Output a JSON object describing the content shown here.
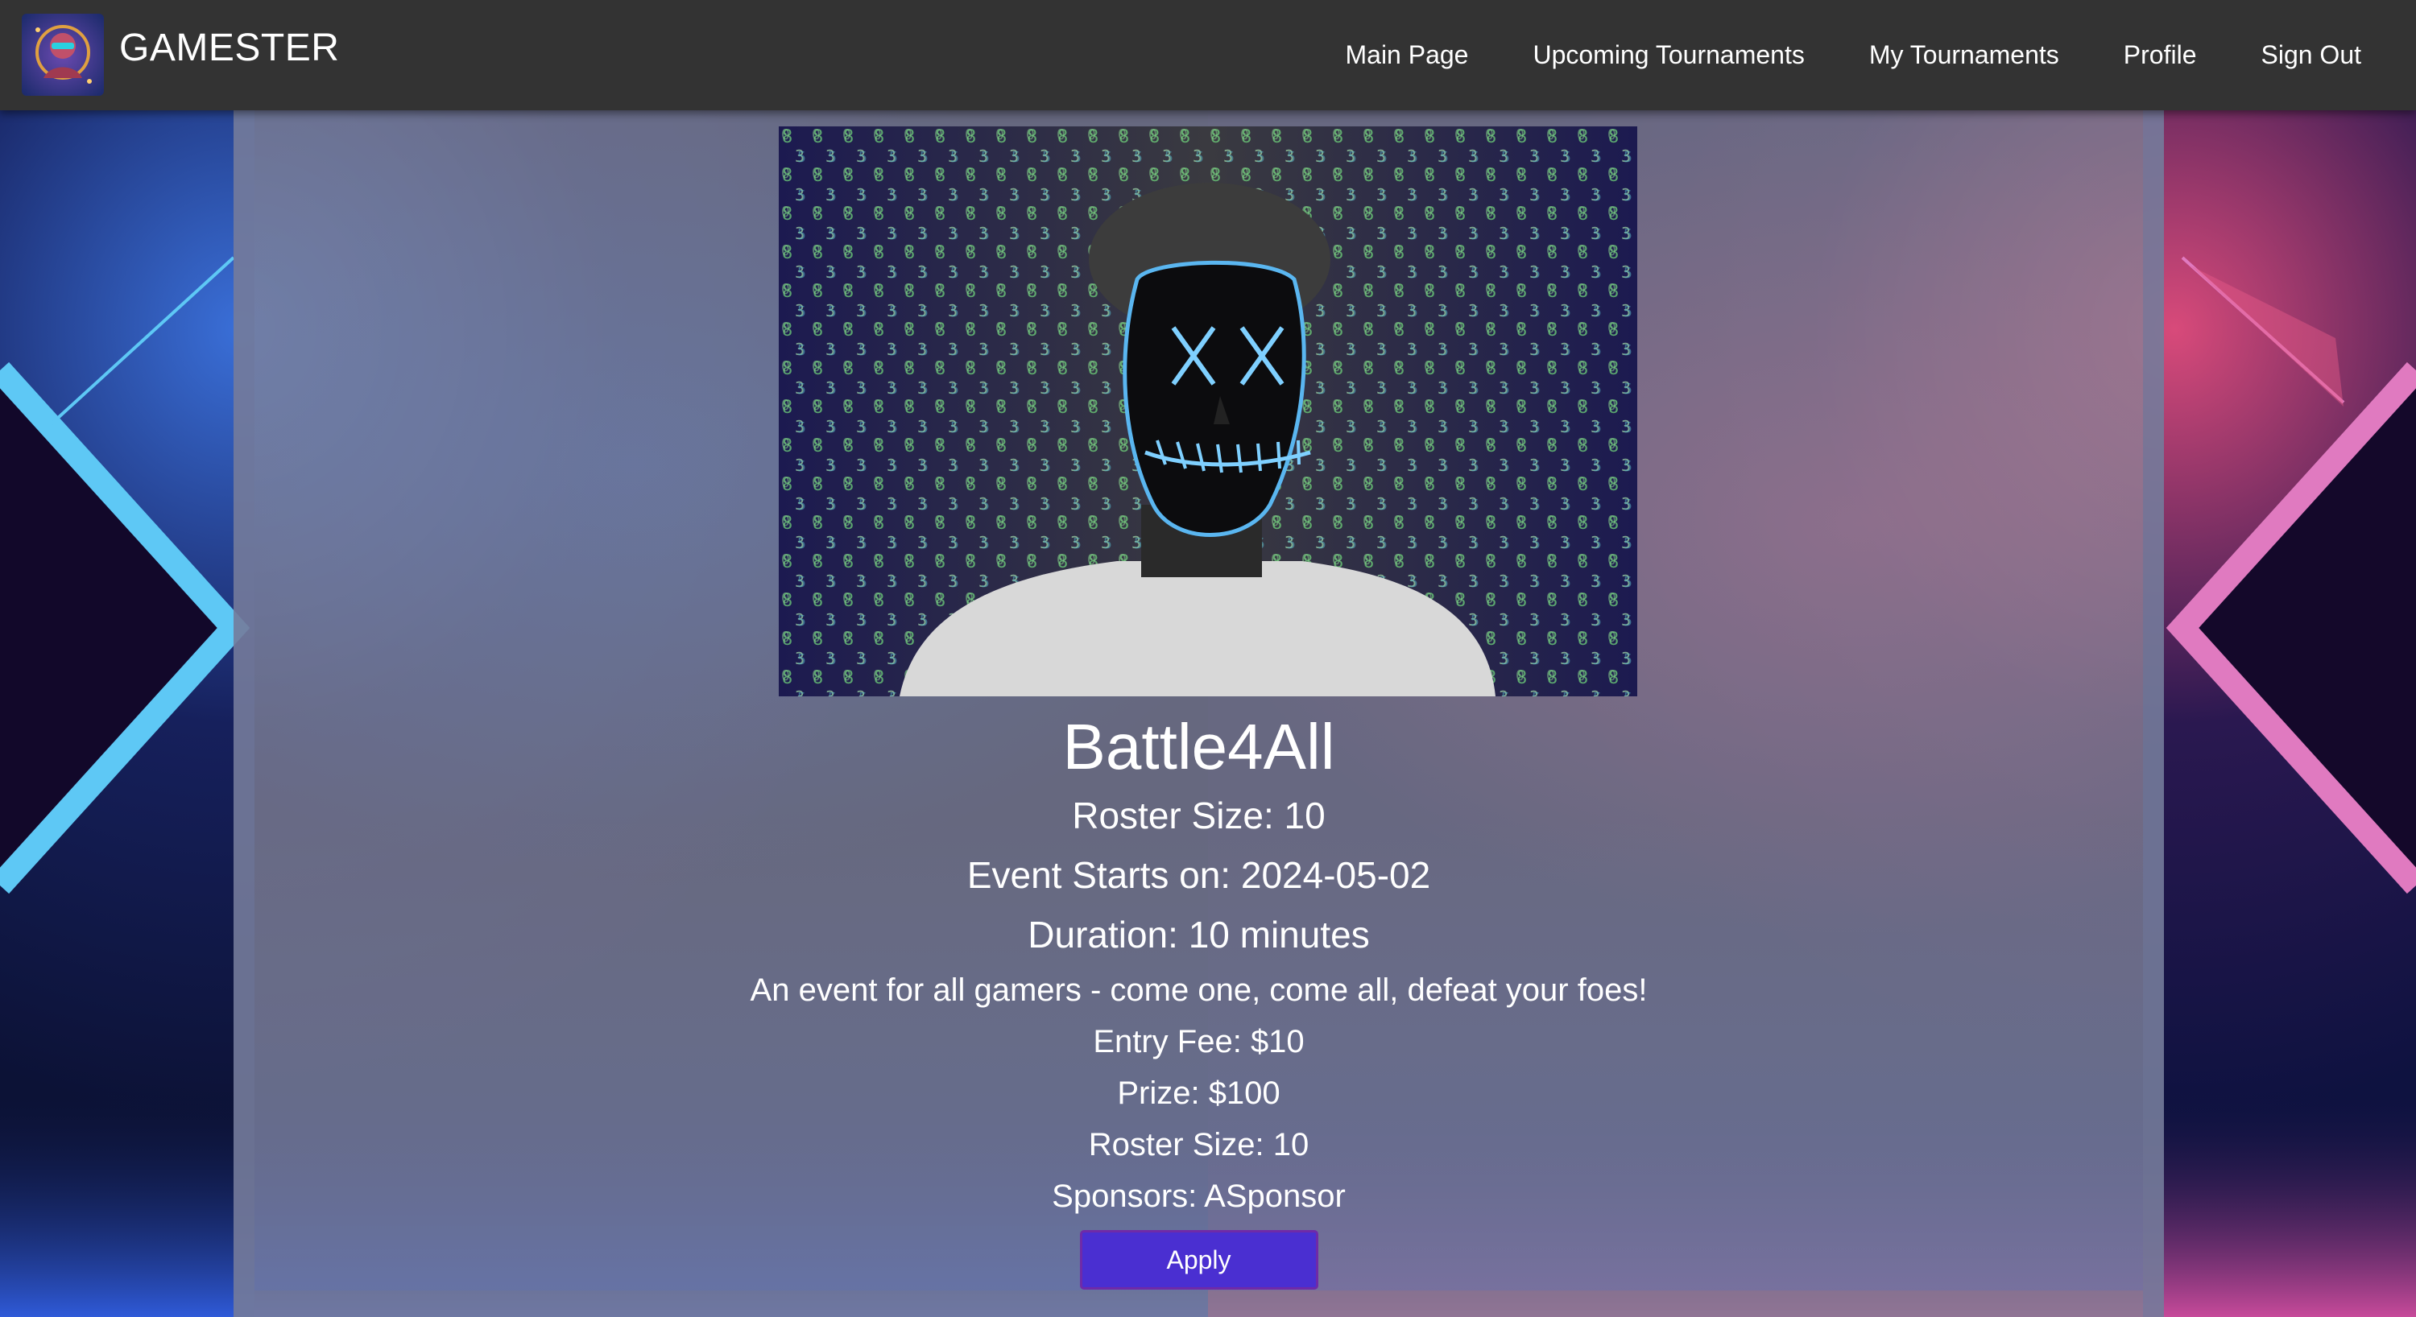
{
  "header": {
    "brand": "GAMESTER",
    "logo_icon": "gamer-mascot-logo",
    "nav": [
      {
        "label": "Main Page"
      },
      {
        "label": "Upcoming Tournaments"
      },
      {
        "label": "My Tournaments"
      },
      {
        "label": "Profile"
      },
      {
        "label": "Sign Out"
      }
    ]
  },
  "tournament": {
    "image_icon": "masked-hacker-matrix-image",
    "name": "Battle4All",
    "roster_size_heading": "Roster Size: 10",
    "start_date": "Event Starts on: 2024-05-02",
    "duration": "Duration: 10 minutes",
    "description": "An event for all gamers - come one, come all, defeat your foes!",
    "entry_fee": "Entry Fee: $10",
    "prize": "Prize: $100",
    "roster_size": "Roster Size: 10",
    "sponsors": "Sponsors: ASponsor",
    "apply_label": "Apply"
  },
  "colors": {
    "navbar": "#333333",
    "apply_button": "#4a2fd1",
    "left_neon": "#5ec8f5",
    "right_neon": "#e07ac0"
  }
}
